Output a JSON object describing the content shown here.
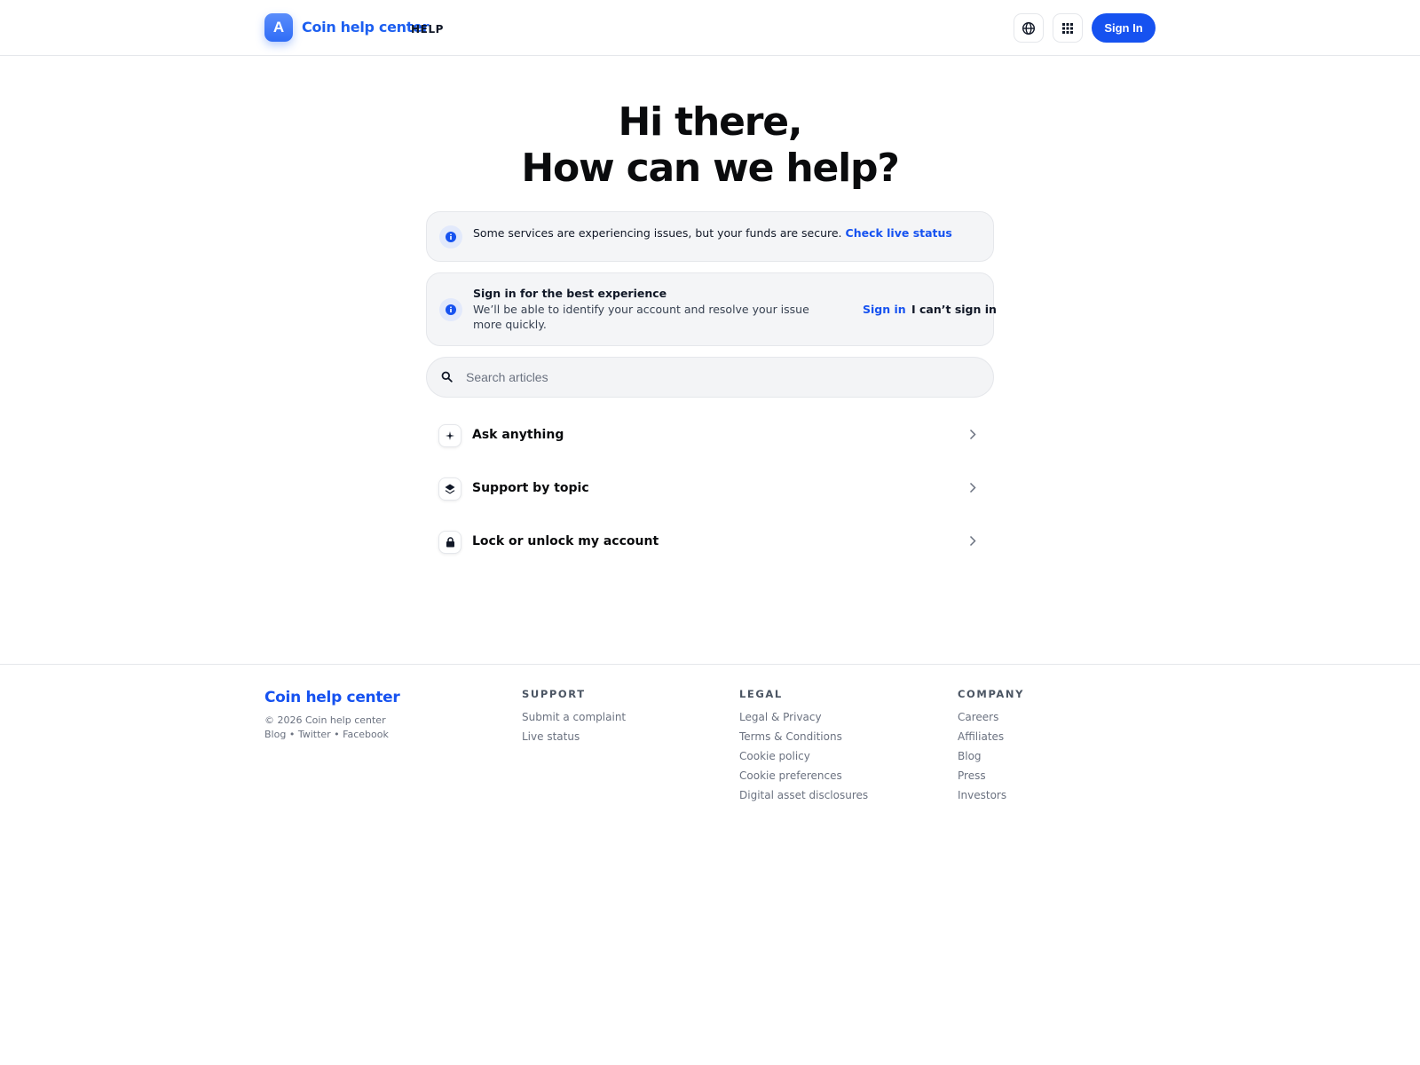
{
  "header": {
    "logo_letter": "A",
    "brand": "Coin help center",
    "brand_suffix": "HELP",
    "signin_label": "Sign In"
  },
  "hero": {
    "line1": "Hi there,",
    "line2": "How can we help?"
  },
  "status_banner": {
    "text": "Some services are experiencing issues, but your funds are secure.",
    "link": "Check live status"
  },
  "signin_card": {
    "title": "Sign in for the best experience",
    "description": "We’ll be able to identify your account and resolve your issue more quickly.",
    "signin_link": "Sign in",
    "cant_signin_link": "I can’t sign in"
  },
  "search": {
    "placeholder": "Search articles",
    "value": ""
  },
  "actions": [
    {
      "label": "Ask anything",
      "icon": "sparkle-icon"
    },
    {
      "label": "Support by topic",
      "icon": "layers-icon"
    },
    {
      "label": "Lock or unlock my account",
      "icon": "lock-icon"
    }
  ],
  "footer": {
    "brand": "Coin help center",
    "copyright": "© 2026 Coin help center",
    "social": [
      "Blog",
      "Twitter",
      "Facebook"
    ],
    "columns": [
      {
        "heading": "SUPPORT",
        "links": [
          "Submit a complaint",
          "Live status"
        ]
      },
      {
        "heading": "LEGAL",
        "links": [
          "Legal & Privacy",
          "Terms & Conditions",
          "Cookie policy",
          "Cookie preferences",
          "Digital asset disclosures"
        ]
      },
      {
        "heading": "COMPANY",
        "links": [
          "Careers",
          "Affiliates",
          "Blog",
          "Press",
          "Investors"
        ]
      }
    ]
  },
  "colors": {
    "accent": "#1652f0",
    "text": "#0a0b0d",
    "muted": "#6b7280",
    "card_bg": "#f4f5f7"
  }
}
